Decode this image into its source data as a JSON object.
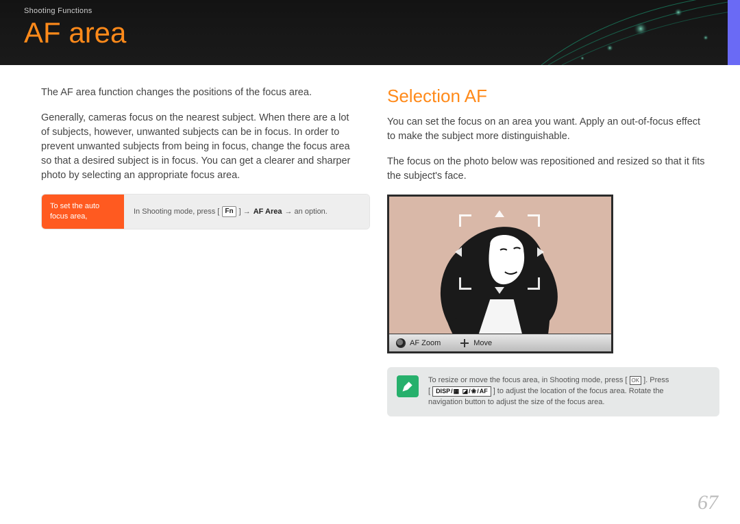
{
  "header": {
    "breadcrumb": "Shooting Functions",
    "title": "AF area"
  },
  "left": {
    "p1": "The AF area function changes the positions of the focus area.",
    "p2": "Generally, cameras focus on the nearest subject. When there are a lot of subjects, however, unwanted subjects can be in focus. In order to prevent unwanted subjects from being in focus, change the focus area so that a desired subject is in focus. You can get a clearer and sharper photo by selecting an appropriate focus area.",
    "instr_label": "To set the auto focus area,",
    "instr_parts": {
      "pre": "In Shooting mode, press [",
      "key": "Fn",
      "mid": "] → ",
      "bold": "AF Area",
      "post": " → an option."
    }
  },
  "right": {
    "section_title": "Selection AF",
    "p1": "You can set the focus on an area you want. Apply an out-of-focus effect to make the subject more distinguishable.",
    "p2": "The focus on the photo below was repositioned and resized so that it fits the subject's face.",
    "preview_bar": {
      "af_zoom": "AF Zoom",
      "move": "Move"
    },
    "note": {
      "line1_pre": "To resize or move the focus area, in Shooting mode, press [",
      "line1_post": "]. Press",
      "badge": {
        "disp": "DISP",
        "sep": "/",
        "grid": "▦",
        "ev": "◪",
        "flower": "❀",
        "af": "AF"
      },
      "line2_tail": " to adjust the location of the focus area. Rotate the",
      "line3": "navigation button to adjust the size of the focus area."
    }
  },
  "page_number": "67"
}
